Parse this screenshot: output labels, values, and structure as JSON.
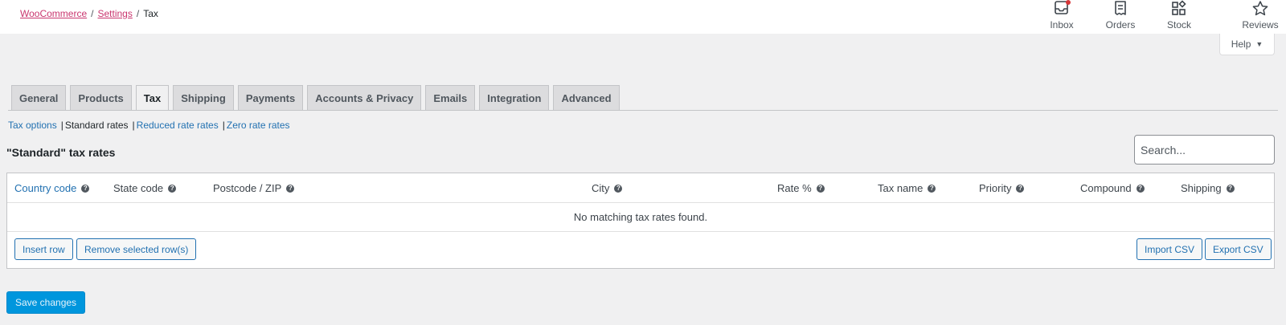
{
  "breadcrumb": {
    "root": "WooCommerce",
    "settings": "Settings",
    "current": "Tax",
    "separator": "/"
  },
  "activity_bar": [
    {
      "label": "Inbox",
      "icon": "inbox-icon"
    },
    {
      "label": "Orders",
      "icon": "orders-icon"
    },
    {
      "label": "Stock",
      "icon": "stock-icon"
    },
    {
      "label": "Reviews",
      "icon": "star-icon"
    }
  ],
  "help": {
    "label": "Help",
    "caret": "▼"
  },
  "tabs": [
    {
      "label": "General"
    },
    {
      "label": "Products"
    },
    {
      "label": "Tax",
      "active": true
    },
    {
      "label": "Shipping"
    },
    {
      "label": "Payments"
    },
    {
      "label": "Accounts & Privacy"
    },
    {
      "label": "Emails"
    },
    {
      "label": "Integration"
    },
    {
      "label": "Advanced"
    }
  ],
  "subnav": {
    "tax_options": "Tax options",
    "standard_rates": "Standard rates",
    "reduced_rates": "Reduced rate rates",
    "zero_rates": "Zero rate rates",
    "separator": "|"
  },
  "section_title": "\"Standard\" tax rates",
  "search": {
    "placeholder": "Search..."
  },
  "table": {
    "columns": [
      "Country code",
      "State code",
      "Postcode / ZIP",
      "City",
      "Rate %",
      "Tax name",
      "Priority",
      "Compound",
      "Shipping"
    ],
    "empty_message": "No matching tax rates found.",
    "help_glyph": "?"
  },
  "actions": {
    "insert_row": "Insert row",
    "remove_rows": "Remove selected row(s)",
    "import_csv": "Import CSV",
    "export_csv": "Export CSV"
  },
  "save_button": "Save changes",
  "colors": {
    "accent": "#2271b1",
    "breadcrumb_link": "#c9356e",
    "save_button": "#0096dd",
    "notification_dot": "#d63638"
  }
}
